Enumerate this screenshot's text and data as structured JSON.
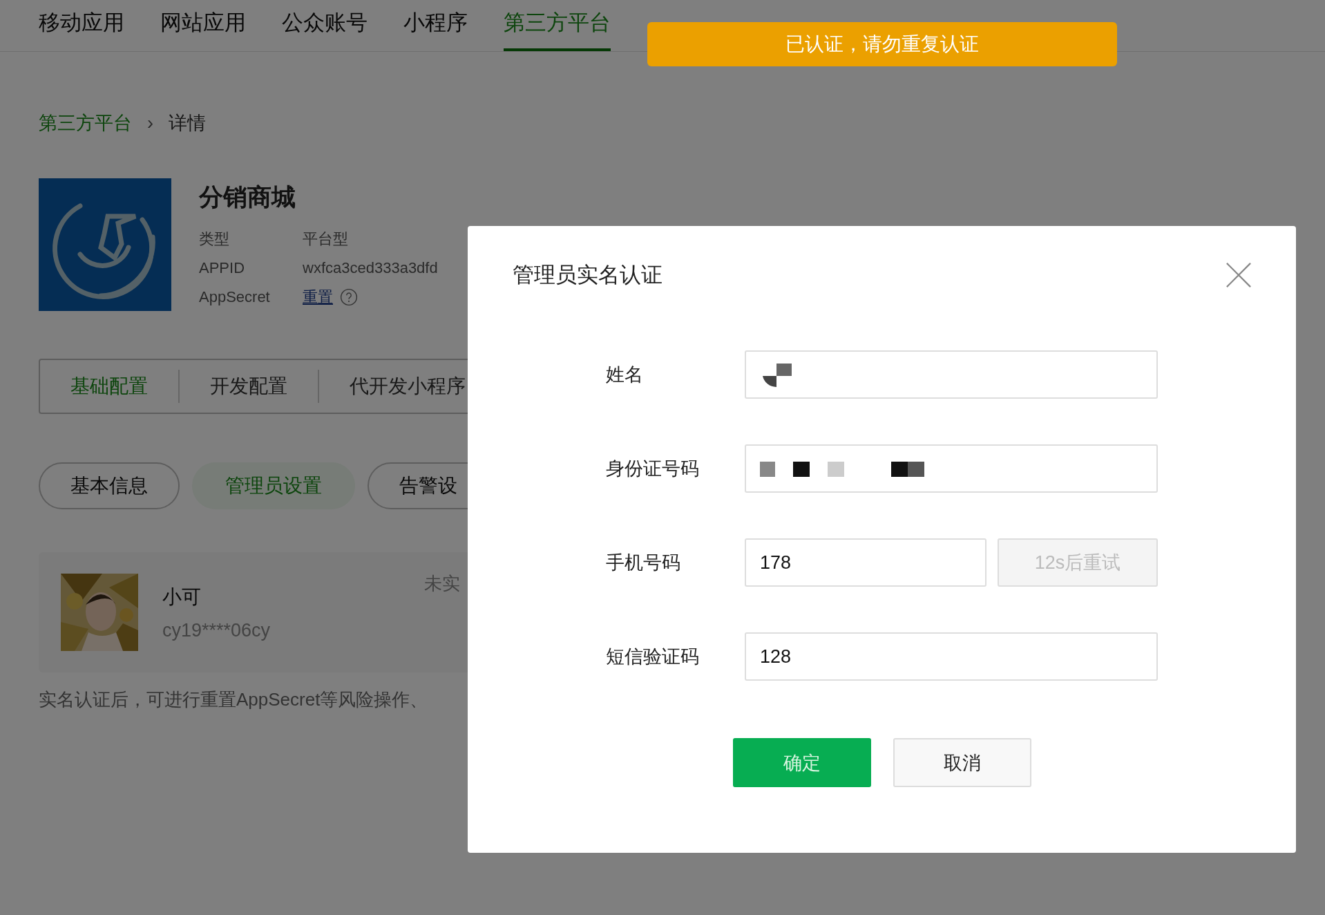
{
  "nav": [
    {
      "label": "移动应用",
      "selected": false
    },
    {
      "label": "网站应用",
      "selected": false
    },
    {
      "label": "公众账号",
      "selected": false
    },
    {
      "label": "小程序",
      "selected": false
    },
    {
      "label": "第三方平台",
      "selected": true
    }
  ],
  "toast": {
    "text": "已认证，请勿重复认证"
  },
  "breadcrumb": {
    "parent": "第三方平台",
    "separator": "›",
    "current": "详情"
  },
  "app": {
    "name": "分销商城",
    "info": [
      {
        "label": "类型",
        "value": "平台型",
        "kind": "text"
      },
      {
        "label": "APPID",
        "value": "wxfca3ced333a3dfd",
        "kind": "text"
      },
      {
        "label": "AppSecret",
        "value": "重置",
        "kind": "link"
      }
    ]
  },
  "config_tabs": [
    {
      "label": "基础配置",
      "selected": true
    },
    {
      "label": "开发配置",
      "selected": false
    },
    {
      "label": "代开发小程序",
      "selected": false
    }
  ],
  "pills": [
    {
      "label": "基本信息",
      "selected": false
    },
    {
      "label": "管理员设置",
      "selected": true
    },
    {
      "label": "告警设",
      "selected": false
    }
  ],
  "admin": {
    "name": "小可",
    "account": "cy19****06cy",
    "status": "未实"
  },
  "note": "实名认证后，可进行重置AppSecret等风险操作、",
  "dialog": {
    "title": "管理员实名认证",
    "fields": [
      {
        "label": "姓名",
        "kind": "masked"
      },
      {
        "label": "身份证号码",
        "kind": "masked"
      },
      {
        "label": "手机号码",
        "kind": "text",
        "value": "178",
        "action": "12s后重试"
      },
      {
        "label": "短信验证码",
        "kind": "text",
        "value": "128"
      }
    ],
    "buttons": [
      {
        "label": "确定",
        "kind": "primary"
      },
      {
        "label": "取消",
        "kind": "default"
      }
    ]
  }
}
